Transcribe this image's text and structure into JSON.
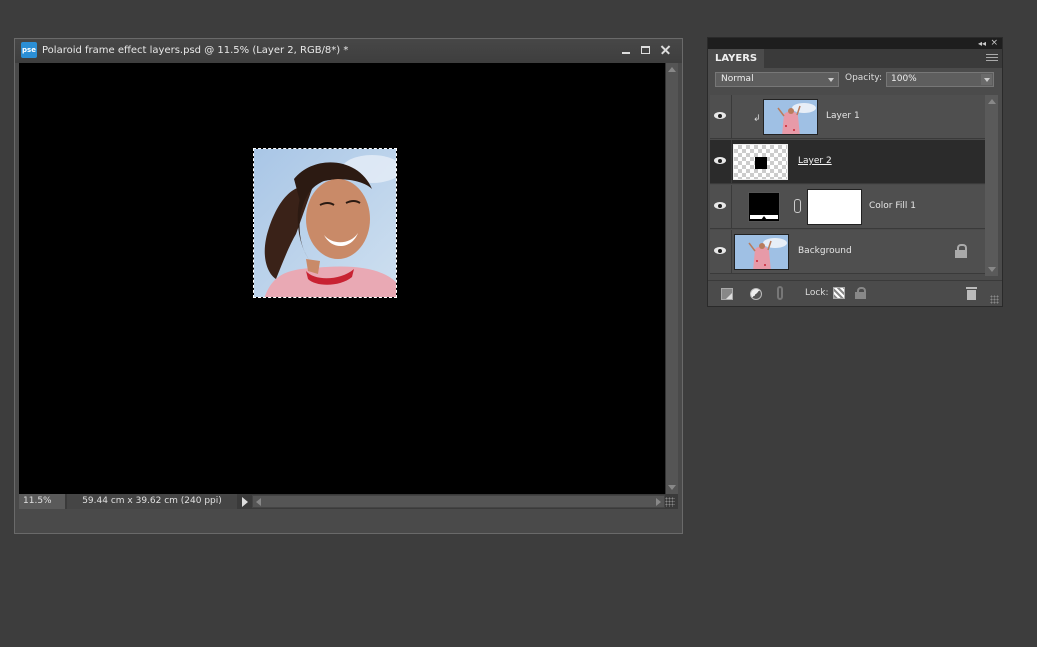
{
  "document": {
    "app_badge": "pse",
    "title": "Polaroid frame effect layers.psd @ 11.5% (Layer 2, RGB/8*) *",
    "status": {
      "zoom": "11.5%",
      "dimensions": "59.44 cm x 39.62 cm (240 ppi)"
    }
  },
  "layers_panel": {
    "tab": "LAYERS",
    "collapse_glyph": "◂◂",
    "close_glyph": "×",
    "blend_mode": "Normal",
    "opacity_label": "Opacity:",
    "opacity_value": "100%",
    "lock_label": "Lock:",
    "layers": [
      {
        "name": "Layer 1",
        "thumbnail": "photo",
        "clipped": true,
        "visible": true,
        "active": false
      },
      {
        "name": "Layer 2",
        "thumbnail": "transparent-with-black-square",
        "visible": true,
        "active": true
      },
      {
        "name": "Color Fill 1",
        "thumbnail": "fill-with-mask",
        "visible": true,
        "active": false
      },
      {
        "name": "Background",
        "thumbnail": "photo",
        "locked": true,
        "visible": true,
        "active": false
      }
    ]
  },
  "colors": {
    "workspace": "#3d3d3d",
    "canvas": "#000000",
    "active_layer": "#2b2b2b",
    "app_badge": "#2b8fd6"
  }
}
